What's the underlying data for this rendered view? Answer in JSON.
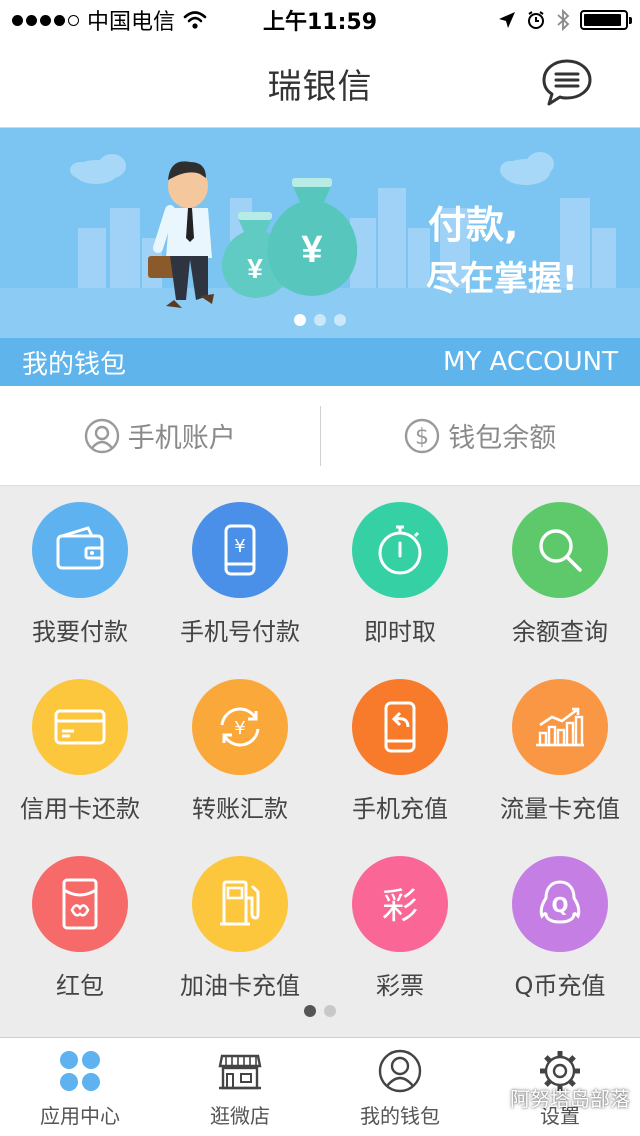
{
  "status_bar": {
    "carrier": "中国电信",
    "time": "上午11:59"
  },
  "nav": {
    "title": "瑞银信",
    "message_icon": "message-bubble-icon"
  },
  "banner": {
    "headline_line1": "付款,",
    "headline_line2": "尽在掌握!",
    "currency_symbol": "¥",
    "slides": 3,
    "active_slide": 1
  },
  "account_bar": {
    "left_label": "我的钱包",
    "right_label": "MY ACCOUNT"
  },
  "info_row": {
    "phone_account": {
      "label": "手机账户",
      "icon": "user-circle-icon"
    },
    "wallet_balance": {
      "label": "钱包余额",
      "icon": "dollar-circle-icon"
    }
  },
  "grid": [
    {
      "label": "我要付款",
      "icon": "wallet-icon",
      "color": "#5db2ef"
    },
    {
      "label": "手机号付款",
      "icon": "phone-yen-icon",
      "color": "#4a90e8"
    },
    {
      "label": "即时取",
      "icon": "stopwatch-icon",
      "color": "#35d0a4"
    },
    {
      "label": "余额查询",
      "icon": "search-icon",
      "color": "#5ec96b"
    },
    {
      "label": "信用卡还款",
      "icon": "credit-card-icon",
      "color": "#fcc63d"
    },
    {
      "label": "转账汇款",
      "icon": "transfer-yen-icon",
      "color": "#fba83a"
    },
    {
      "label": "手机充值",
      "icon": "phone-recharge-icon",
      "color": "#f77b2a"
    },
    {
      "label": "流量卡充值",
      "icon": "data-chart-icon",
      "color": "#fa9745"
    },
    {
      "label": "红包",
      "icon": "red-envelope-icon",
      "color": "#f76a6a"
    },
    {
      "label": "加油卡充值",
      "icon": "fuel-pump-icon",
      "color": "#fcc63d"
    },
    {
      "label": "彩票",
      "icon": "lottery-icon",
      "color": "#fa6796",
      "glyph": "彩"
    },
    {
      "label": "Q币充值",
      "icon": "qq-penguin-icon",
      "color": "#c57fe4"
    }
  ],
  "grid_pages": {
    "count": 2,
    "active": 1
  },
  "tab_bar": [
    {
      "label": "应用中心",
      "icon": "apps-grid-icon",
      "active": true
    },
    {
      "label": "逛微店",
      "icon": "store-icon",
      "active": false
    },
    {
      "label": "我的钱包",
      "icon": "user-circle-icon",
      "active": false
    },
    {
      "label": "设置",
      "icon": "gear-icon",
      "active": false
    }
  ],
  "watermark": {
    "text": "阿努塔岛部落"
  }
}
